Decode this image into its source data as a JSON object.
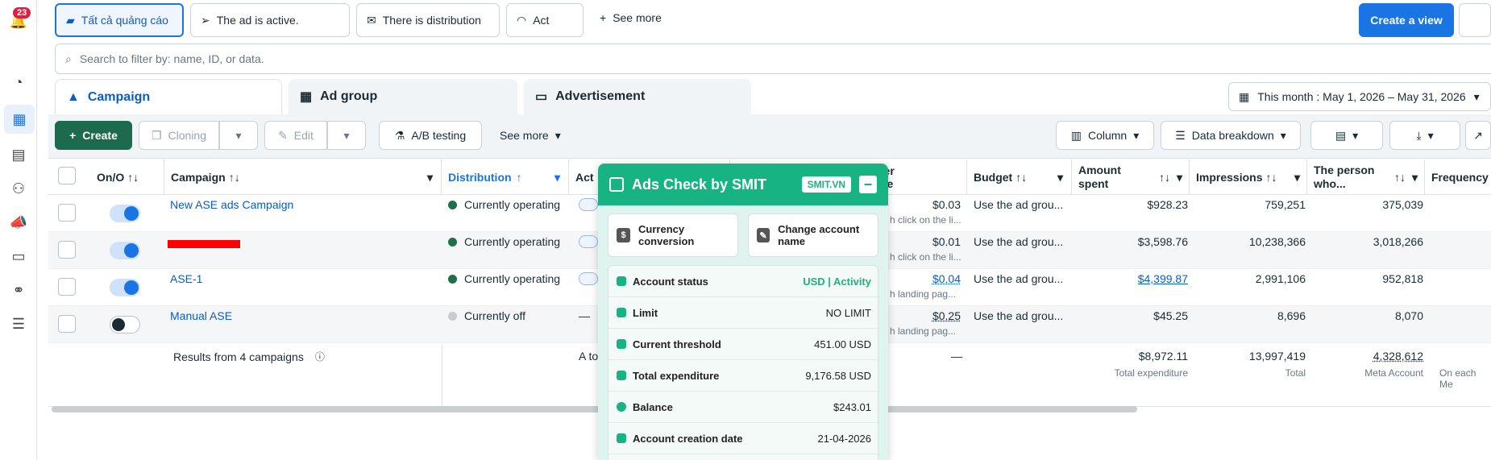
{
  "rail": {
    "notifications": "23"
  },
  "filters": [
    {
      "label": "Tất cả quảng cáo"
    },
    {
      "label": "The ad is active."
    },
    {
      "label": "There is distribution"
    },
    {
      "label": "Act"
    }
  ],
  "filters_more": "See more",
  "create_view": "Create a view",
  "search": {
    "placeholder": "Search to filter by: name, ID, or data."
  },
  "tabs": {
    "campaign": "Campaign",
    "adgroup": "Ad group",
    "ad": "Advertisement"
  },
  "date_range": "This month : May 1, 2026 – May 31, 2026",
  "toolbar": {
    "create": "Create",
    "cloning": "Cloning",
    "edit": "Edit",
    "ab": "A/B testing",
    "more": "See more",
    "column": "Column",
    "breakdown": "Data breakdown"
  },
  "headers": {
    "onoff": "On/O",
    "campaign": "Campaign",
    "distribution": "Distribution",
    "act": "Act",
    "per": "per",
    "me": "me",
    "budget": "Budget",
    "amount1": "Amount",
    "amount2": "spent",
    "impr": "Impressions",
    "person1": "The person",
    "person2": "who...",
    "freq": "Frequency"
  },
  "rows": [
    {
      "name": "New ASE ads Campaign",
      "status": "Currently operating",
      "status_color": "#1f6f4a",
      "cpr": "$0.03",
      "cpr_sub": "h click on the li...",
      "budget": "Use the ad grou...",
      "spent": "$928.23",
      "impr": "759,251",
      "reach": "375,039",
      "on": true
    },
    {
      "name": "",
      "status": "Currently operating",
      "status_color": "#1f6f4a",
      "cpr": "$0.01",
      "cpr_sub": "h click on the li...",
      "budget": "Use the ad grou...",
      "spent": "$3,598.76",
      "impr": "10,238,366",
      "reach": "3,018,266",
      "on": true
    },
    {
      "name": "ASE-1",
      "status": "Currently operating",
      "status_color": "#1f6f4a",
      "cpr": "$0.04",
      "cpr_sub": "h landing pag...",
      "budget": "Use the ad grou...",
      "spent": "$4,399.87",
      "impr": "2,991,106",
      "reach": "952,818",
      "on": true
    },
    {
      "name": "Manual ASE",
      "status": "Currently off",
      "status_color": "#c8ccd0",
      "cpr": "$0.25",
      "cpr_sub": "h landing pag...",
      "budget": "Use the ad grou...",
      "spent": "$45.25",
      "impr": "8,696",
      "reach": "8,070",
      "on": false
    }
  ],
  "act_dash": "—",
  "totals": {
    "label": "Results from 4 campaigns",
    "act": "A to",
    "cpr": "—",
    "spent": "$8,972.11",
    "spent_sub": "Total expenditure",
    "impr": "13,997,419",
    "impr_sub": "Total",
    "reach": "4,328,612",
    "reach_sub": "Meta Account",
    "freq_sub": "On each Me"
  },
  "overlay": {
    "title": "Ads Check by SMIT",
    "brand": "SMIT.VN",
    "btn1": "Currency conversion",
    "btn2": "Change account name",
    "rows": [
      {
        "k": "Account status",
        "v": "USD | Activity"
      },
      {
        "k": "Limit",
        "v": "NO LIMIT"
      },
      {
        "k": "Current threshold",
        "v": "451.00 USD"
      },
      {
        "k": "Total expenditure",
        "v": "9,176.58 USD"
      },
      {
        "k": "Balance",
        "v": "$243.01"
      },
      {
        "k": "Account creation date",
        "v": "21-04-2026"
      }
    ]
  },
  "colors": {
    "accent": "#1b74e4",
    "create": "#1d6b4e",
    "overlay": "#17b383"
  }
}
